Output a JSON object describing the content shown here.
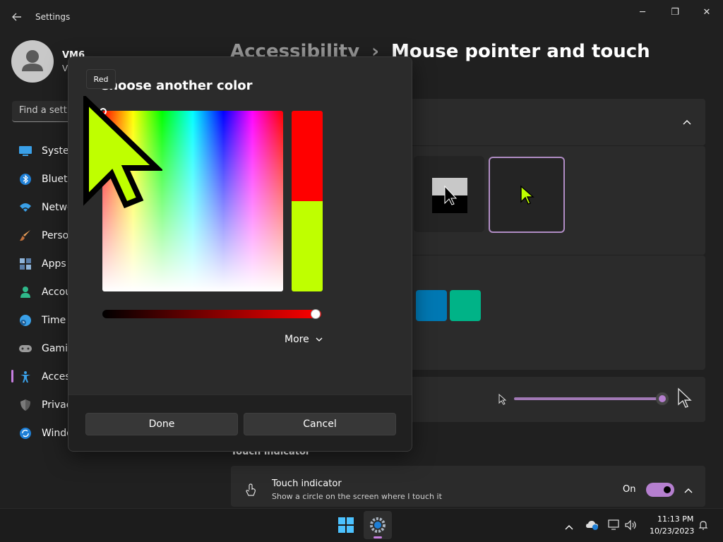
{
  "window": {
    "title": "Settings",
    "minimize_glyph": "─",
    "maximize_glyph": "❐",
    "close_glyph": "✕"
  },
  "user": {
    "name": "VM6",
    "subtitle": "V"
  },
  "search": {
    "placeholder": "Find a setti"
  },
  "sidebar": {
    "items": [
      {
        "label": "Syster",
        "icon": "system-icon"
      },
      {
        "label": "Blueto",
        "icon": "bluetooth-icon"
      },
      {
        "label": "Netwo",
        "icon": "network-icon"
      },
      {
        "label": "Person",
        "icon": "personalization-icon"
      },
      {
        "label": "Apps",
        "icon": "apps-icon"
      },
      {
        "label": "Accou",
        "icon": "accounts-icon"
      },
      {
        "label": "Time",
        "icon": "time-language-icon"
      },
      {
        "label": "Gamin",
        "icon": "gaming-icon"
      },
      {
        "label": "Acces",
        "icon": "accessibility-icon",
        "active": true
      },
      {
        "label": "Privac",
        "icon": "privacy-icon"
      },
      {
        "label": "Windo",
        "icon": "windows-update-icon"
      }
    ]
  },
  "header": {
    "breadcrumb_parent": "Accessibility",
    "separator": "›",
    "title": "Mouse pointer and touch"
  },
  "main": {
    "swatch_colors": [
      "#0078b3",
      "#00b387"
    ],
    "touch_section_label": "Touch indicator",
    "touch_indicator": {
      "title": "Touch indicator",
      "description": "Show a circle on the screen where I touch it",
      "state_label": "On",
      "enabled": true
    },
    "pointer_size_level": 1.0
  },
  "dialog": {
    "title": "Choose another color",
    "tooltip": "Red",
    "more_label": "More",
    "done_label": "Done",
    "cancel_label": "Cancel",
    "current_color": "#ff0000",
    "new_color": "#bfff00"
  },
  "taskbar": {
    "time": "11:13 PM",
    "date": "10/23/2023"
  },
  "colors": {
    "accent": "#b57fcf",
    "background": "#202020",
    "card": "#2b2b2b"
  }
}
